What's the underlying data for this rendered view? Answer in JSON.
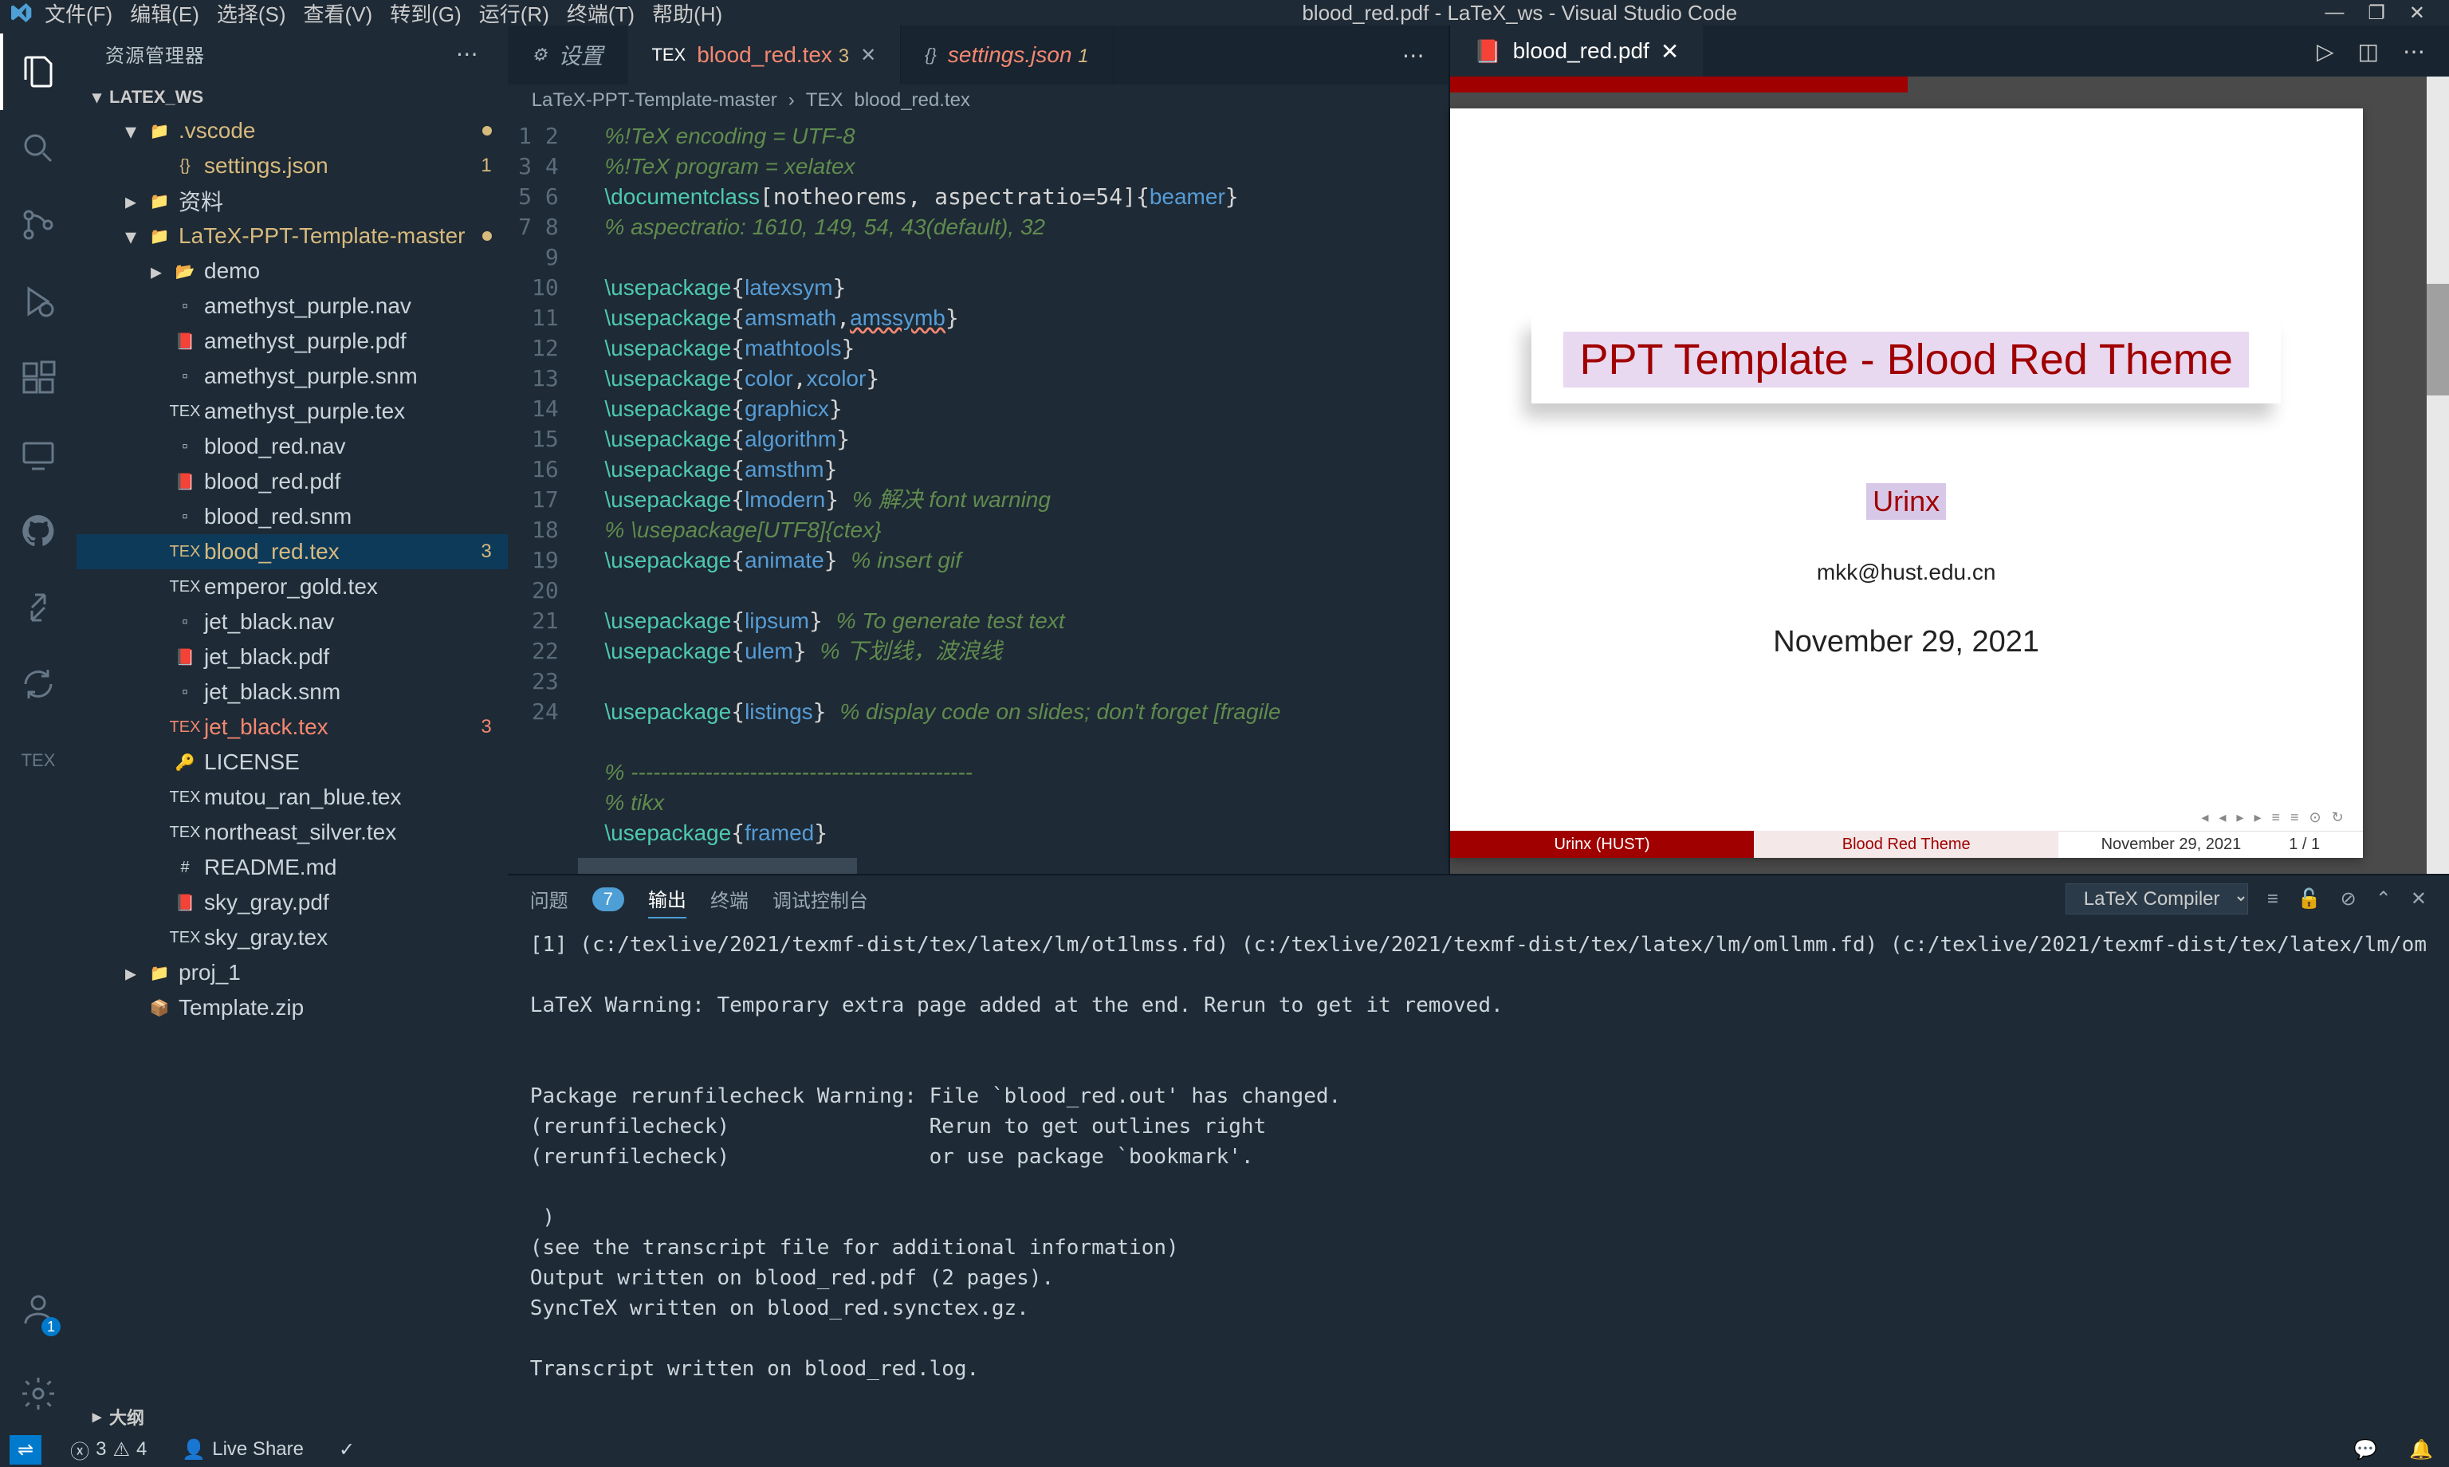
{
  "window": {
    "title": "blood_red.pdf - LaTeX_ws - Visual Studio Code"
  },
  "menubar": [
    "文件(F)",
    "编辑(E)",
    "选择(S)",
    "查看(V)",
    "转到(G)",
    "运行(R)",
    "终端(T)",
    "帮助(H)"
  ],
  "sidebar": {
    "header": "资源管理器",
    "section": "LATEX_WS",
    "outline": "大纲",
    "tree": [
      {
        "indent": 1,
        "chev": "▾",
        "icon": "folder",
        "label": ".vscode",
        "mod": true,
        "dot": true
      },
      {
        "indent": 2,
        "icon": "json",
        "label": "settings.json",
        "mod": true,
        "badge": "1"
      },
      {
        "indent": 1,
        "chev": "▸",
        "icon": "folder",
        "label": "资料"
      },
      {
        "indent": 1,
        "chev": "▾",
        "icon": "folder",
        "label": "LaTeX-PPT-Template-master",
        "mod": true,
        "dot": true
      },
      {
        "indent": 2,
        "chev": "▸",
        "icon": "folder-o",
        "label": "demo"
      },
      {
        "indent": 2,
        "icon": "file",
        "label": "amethyst_purple.nav"
      },
      {
        "indent": 2,
        "icon": "pdf",
        "label": "amethyst_purple.pdf"
      },
      {
        "indent": 2,
        "icon": "file",
        "label": "amethyst_purple.snm"
      },
      {
        "indent": 2,
        "icon": "tex",
        "label": "amethyst_purple.tex"
      },
      {
        "indent": 2,
        "icon": "file",
        "label": "blood_red.nav"
      },
      {
        "indent": 2,
        "icon": "pdf",
        "label": "blood_red.pdf"
      },
      {
        "indent": 2,
        "icon": "file",
        "label": "blood_red.snm"
      },
      {
        "indent": 2,
        "icon": "tex",
        "label": "blood_red.tex",
        "mod": true,
        "badge": "3",
        "sel": true
      },
      {
        "indent": 2,
        "icon": "tex",
        "label": "emperor_gold.tex"
      },
      {
        "indent": 2,
        "icon": "file",
        "label": "jet_black.nav"
      },
      {
        "indent": 2,
        "icon": "pdf",
        "label": "jet_black.pdf"
      },
      {
        "indent": 2,
        "icon": "file",
        "label": "jet_black.snm"
      },
      {
        "indent": 2,
        "icon": "tex",
        "label": "jet_black.tex",
        "err": true,
        "badge": "3"
      },
      {
        "indent": 2,
        "icon": "lic",
        "label": "LICENSE"
      },
      {
        "indent": 2,
        "icon": "tex",
        "label": "mutou_ran_blue.tex"
      },
      {
        "indent": 2,
        "icon": "tex",
        "label": "northeast_silver.tex"
      },
      {
        "indent": 2,
        "icon": "md",
        "label": "README.md"
      },
      {
        "indent": 2,
        "icon": "pdf",
        "label": "sky_gray.pdf"
      },
      {
        "indent": 2,
        "icon": "tex",
        "label": "sky_gray.tex"
      },
      {
        "indent": 1,
        "chev": "▸",
        "icon": "folder",
        "label": "proj_1"
      },
      {
        "indent": 1,
        "icon": "zip",
        "label": "Template.zip"
      }
    ]
  },
  "tabs": [
    {
      "icon": "gear",
      "label": "设置",
      "italic": true
    },
    {
      "icon": "tex",
      "label": "blood_red.tex",
      "badge": "3",
      "active": true,
      "mod": true,
      "badgeColor": "#d7ba7d"
    },
    {
      "icon": "json",
      "label": "settings.json",
      "badge": "1",
      "mod": true,
      "badgeColor": "#d7ba7d"
    }
  ],
  "breadcrumb": [
    "LaTeX-PPT-Template-master",
    "blood_red.tex"
  ],
  "editor_lines": [
    {
      "n": 1,
      "html": "<span class='c-comment'>%!TeX encoding = UTF-8</span>"
    },
    {
      "n": 2,
      "html": "<span class='c-comment'>%!TeX program = xelatex</span>"
    },
    {
      "n": 3,
      "html": "<span class='c-func'>\\documentclass</span>[notheorems, aspectratio=54]{<span class='c-key'>beamer</span>}"
    },
    {
      "n": 4,
      "html": "<span class='c-comment'>% aspectratio: 1610, 149, 54, 43(default), 32</span>"
    },
    {
      "n": 5,
      "html": ""
    },
    {
      "n": 6,
      "html": "<span class='c-func'>\\usepackage</span>{<span class='c-key'>latexsym</span>}"
    },
    {
      "n": 7,
      "html": "<span class='c-func'>\\usepackage</span>{<span class='c-key'>amsmath</span>,<span class='c-key c-err'>amssymb</span>}"
    },
    {
      "n": 8,
      "html": "<span class='c-func'>\\usepackage</span>{<span class='c-key'>mathtools</span>}"
    },
    {
      "n": 9,
      "html": "<span class='c-func'>\\usepackage</span>{<span class='c-key'>color</span>,<span class='c-key'>xcolor</span>}"
    },
    {
      "n": 10,
      "html": "<span class='c-func'>\\usepackage</span>{<span class='c-key'>graphicx</span>}"
    },
    {
      "n": 11,
      "html": "<span class='c-func'>\\usepackage</span>{<span class='c-key'>algorithm</span>}"
    },
    {
      "n": 12,
      "html": "<span class='c-func'>\\usepackage</span>{<span class='c-key'>amsthm</span>}"
    },
    {
      "n": 13,
      "html": "<span class='c-func'>\\usepackage</span>{<span class='c-key'>lmodern</span>} <span class='c-comment'>% 解决 font warning</span>"
    },
    {
      "n": 14,
      "html": "<span class='c-comment'>% \\usepackage[UTF8]{ctex}</span>"
    },
    {
      "n": 15,
      "html": "<span class='c-func'>\\usepackage</span>{<span class='c-key'>animate</span>} <span class='c-comment'>% insert gif</span>"
    },
    {
      "n": 16,
      "html": ""
    },
    {
      "n": 17,
      "html": "<span class='c-func'>\\usepackage</span>{<span class='c-key'>lipsum</span>} <span class='c-comment'>% To generate test text</span>"
    },
    {
      "n": 18,
      "html": "<span class='c-func'>\\usepackage</span>{<span class='c-key'>ulem</span>} <span class='c-comment'>% 下划线，波浪线</span>"
    },
    {
      "n": 19,
      "html": ""
    },
    {
      "n": 20,
      "html": "<span class='c-func'>\\usepackage</span>{<span class='c-key'>listings</span>} <span class='c-comment'>% display code on slides; don't forget [fragile</span>"
    },
    {
      "n": 21,
      "html": ""
    },
    {
      "n": 22,
      "html": "<span class='c-comment'>% ----------------------------------------------</span>"
    },
    {
      "n": 23,
      "html": "<span class='c-comment'>% tikx</span>"
    },
    {
      "n": 24,
      "html": "<span class='c-func'>\\usepackage</span>{<span class='c-key'>framed</span>}"
    }
  ],
  "pdf_tab": {
    "label": "blood_red.pdf"
  },
  "pdf_slide": {
    "title": "PPT Template - Blood Red Theme",
    "author": "Urinx",
    "email": "mkk@hust.edu.cn",
    "date": "November 29, 2021",
    "footer_author": "Urinx (HUST)",
    "footer_title": "Blood Red Theme",
    "footer_date": "November 29, 2021",
    "footer_page": "1 / 1"
  },
  "panel": {
    "tabs": [
      "问题",
      "输出",
      "终端",
      "调试控制台"
    ],
    "active": "输出",
    "problems_count": "7",
    "dropdown": "LaTeX Compiler",
    "output": "[1] (c:/texlive/2021/texmf-dist/tex/latex/lm/ot1lmss.fd) (c:/texlive/2021/texmf-dist/tex/latex/lm/omllmm.fd) (c:/texlive/2021/texmf-dist/tex/latex/lm/om\n\nLaTeX Warning: Temporary extra page added at the end. Rerun to get it removed.\n\n\nPackage rerunfilecheck Warning: File `blood_red.out' has changed.\n(rerunfilecheck)                Rerun to get outlines right\n(rerunfilecheck)                or use package `bookmark'.\n\n )\n(see the transcript file for additional information)\nOutput written on blood_red.pdf (2 pages).\nSyncTeX written on blood_red.synctex.gz.\n\nTranscript written on blood_red.log."
  },
  "statusbar": {
    "errors": "3",
    "warnings": "4",
    "liveshare": "Live Share"
  }
}
